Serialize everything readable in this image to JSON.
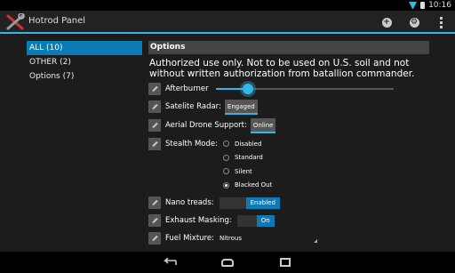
{
  "status_bar": {
    "time": "10:16"
  },
  "action_bar": {
    "title": "Hotrod Panel",
    "icons": [
      "add-icon",
      "settings-icon",
      "overflow-menu-icon"
    ]
  },
  "sidebar": {
    "items": [
      {
        "label": "ALL (10)",
        "active": true
      },
      {
        "label": "OTHER (2)",
        "active": false
      },
      {
        "label": "Options (7)",
        "active": false
      }
    ]
  },
  "main": {
    "header": "Options",
    "notice": "Authorized use only.  Not to be used on U.S. soil and not without written authorization from batallion commander.",
    "afterburner": {
      "label": "Afterburner",
      "level": 0.18
    },
    "satellite_radar": {
      "label": "Satelite Radar:",
      "value": "Engaged"
    },
    "aerial_drone": {
      "label": "Aerial Drone Support:",
      "value": "Online"
    },
    "stealth_mode": {
      "label": "Stealth Mode:",
      "options": [
        "Disabled",
        "Standard",
        "Silent",
        "Blacked Out"
      ],
      "selected": "Blacked Out"
    },
    "nano_treads": {
      "label": "Nano treads:",
      "value": "Enabled"
    },
    "exhaust_masking": {
      "label": "Exhaust Masking:",
      "value": "On"
    },
    "fuel_mixture": {
      "label": "Fuel Mixture:",
      "value": "Nitrous"
    }
  },
  "colors": {
    "accent": "#33b5e5",
    "selected": "#0b7ab5"
  }
}
